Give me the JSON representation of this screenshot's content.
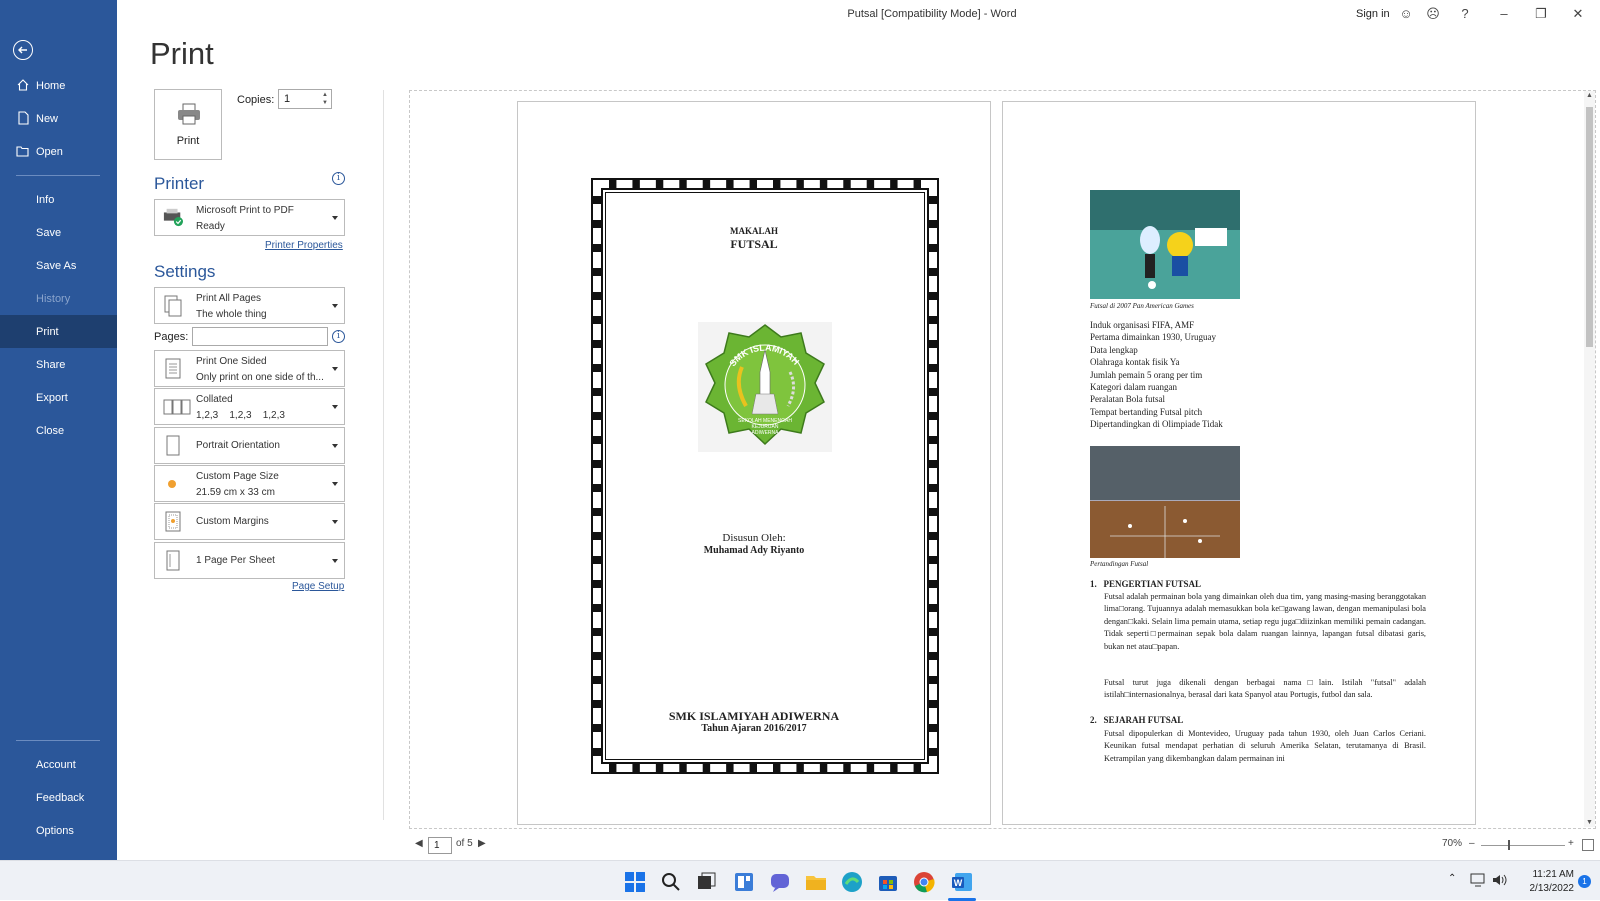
{
  "window": {
    "title": "Putsal [Compatibility Mode]  -  Word",
    "sign_in": "Sign in",
    "help": "?",
    "minimize": "–",
    "restore": "❐",
    "close": "✕"
  },
  "sidebar": {
    "back": "back-arrow-icon",
    "items": [
      {
        "label": "Home",
        "icon": "home-icon"
      },
      {
        "label": "New",
        "icon": "new-document-icon"
      },
      {
        "label": "Open",
        "icon": "open-folder-icon"
      },
      {
        "label": "Info"
      },
      {
        "label": "Save"
      },
      {
        "label": "Save As"
      },
      {
        "label": "History"
      },
      {
        "label": "Print"
      },
      {
        "label": "Share"
      },
      {
        "label": "Export"
      },
      {
        "label": "Close"
      }
    ],
    "bottom_items": [
      {
        "label": "Account"
      },
      {
        "label": "Feedback"
      },
      {
        "label": "Options"
      }
    ]
  },
  "print_panel": {
    "heading": "Print",
    "print_button": "Print",
    "copies_label": "Copies:",
    "copies_value": "1",
    "printer_heading": "Printer",
    "printer_name": "Microsoft Print to PDF",
    "printer_status": "Ready",
    "printer_properties": "Printer Properties",
    "settings_heading": "Settings",
    "settings": [
      {
        "line1": "Print All Pages",
        "line2": "The whole thing"
      },
      {
        "line1": "Print One Sided",
        "line2": "Only print on one side of th..."
      },
      {
        "line1": "Collated",
        "line2": "1,2,3    1,2,3    1,2,3"
      },
      {
        "line1": "Portrait Orientation",
        "line2": ""
      },
      {
        "line1": "Custom Page Size",
        "line2": "21.59 cm x 33 cm"
      },
      {
        "line1": "Custom Margins",
        "line2": ""
      },
      {
        "line1": "1 Page Per Sheet",
        "line2": ""
      }
    ],
    "pages_label": "Pages:",
    "pages_value": "",
    "page_setup": "Page Setup"
  },
  "preview": {
    "cover": {
      "makalah": "MAKALAH",
      "futsal": "FUTSAL",
      "logo_top_text": "SMK ISLAMIYAH",
      "logo_bottom_text_1": "SEKOLAH MENENGAH",
      "logo_bottom_text_2": "KEJURUAN",
      "logo_bottom_text_3": "ADIWERNA",
      "disusun": "Disusun Oleh:",
      "author": "Muhamad Ady Riyanto",
      "school": "SMK ISLAMIYAH ADIWERNA",
      "year": "Tahun Ajaran 2016/2017"
    },
    "page2": {
      "caption1": "Futsal di 2007 Pan American Games",
      "facts": [
        "Induk organisasi FIFA, AMF",
        "Pertama dimainkan 1930, Uruguay",
        "Data lengkap",
        "Olahraga kontak fisik Ya",
        "Jumlah pemain 5 orang per tim",
        "Kategori dalam ruangan",
        "Peralatan Bola futsal",
        "Tempat bertanding Futsal pitch",
        "Dipertandingkan di Olimpiade Tidak"
      ],
      "caption2": "Pertandingan Futsal",
      "section1_title": "1.   PENGERTIAN FUTSAL",
      "section1_p1": "Futsal adalah permainan bola yang dimainkan oleh dua tim, yang masing-masing beranggotakan lima□orang. Tujuannya adalah memasukkan bola ke□gawang lawan, dengan memanipulasi bola dengan□kaki. Selain lima pemain utama, setiap regu juga□diizinkan memiliki pemain cadangan. Tidak seperti□permainan sepak bola dalam ruangan lainnya, lapangan futsal dibatasi garis, bukan net atau□papan.",
      "section1_p2": "Futsal turut juga dikenali dengan berbagai nama□lain. Istilah \"futsal\" adalah istilah□internasionalnya, berasal dari kata Spanyol atau Portugis, futbol dan sala.",
      "section2_title": "2.   SEJARAH FUTSAL",
      "section2_p1": "Futsal dipopulerkan di Montevideo, Uruguay pada tahun 1930, oleh Juan Carlos Ceriani. Keunikan futsal mendapat perhatian di seluruh Amerika Selatan, terutamanya di Brasil. Ketrampilan yang dikembangkan dalam permainan ini"
    }
  },
  "status": {
    "page_current": "1",
    "page_total": "of 5",
    "zoom": "70%",
    "zoom_minus": "–",
    "zoom_plus": "+"
  },
  "taskbar": {
    "time": "11:21 AM",
    "date": "2/13/2022",
    "notifications": "1"
  },
  "colors": {
    "accent": "#2b579a",
    "active_nav": "#1e3f6f"
  }
}
